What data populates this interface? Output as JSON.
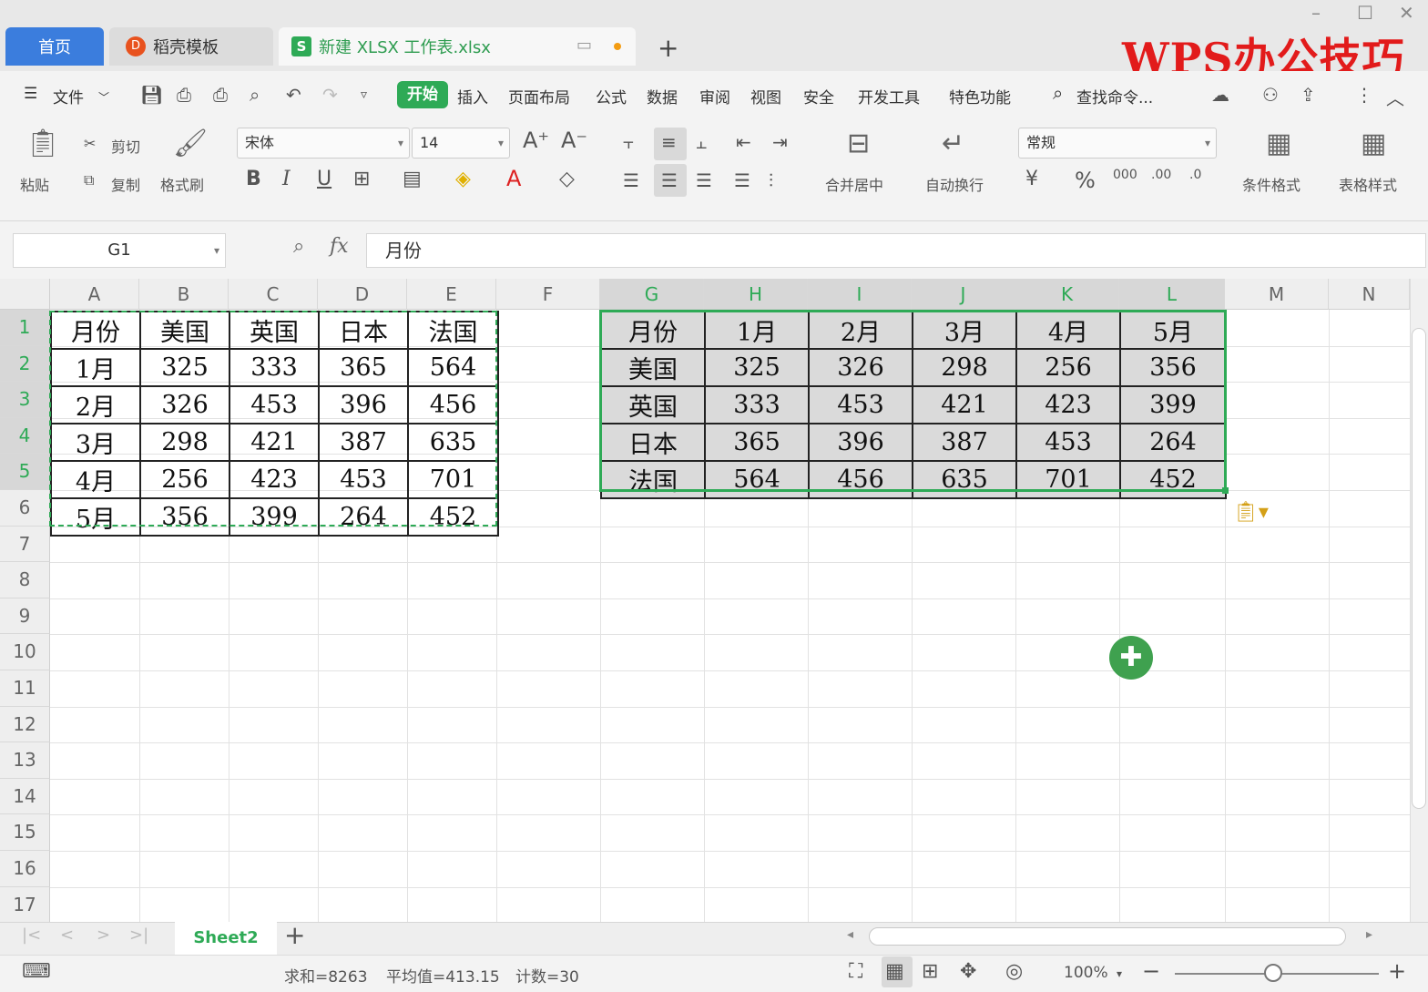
{
  "tabs": {
    "home": "首页",
    "template": "稻壳模板",
    "file": "新建 XLSX 工作表.xlsx",
    "new_tab": "+"
  },
  "watermark": "WPS办公技巧",
  "menu": {
    "file": "文件",
    "items": [
      "开始",
      "插入",
      "页面布局",
      "公式",
      "数据",
      "审阅",
      "视图",
      "安全",
      "开发工具",
      "特色功能"
    ],
    "search": "查找命令..."
  },
  "ribbon": {
    "paste": "粘贴",
    "cut": "剪切",
    "copy": "复制",
    "format_painter": "格式刷",
    "font_name": "宋体",
    "font_size": "14",
    "merge_center": "合并居中",
    "auto_wrap": "自动换行",
    "number_format": "常规",
    "conditional_format": "条件格式",
    "table_style": "表格样式",
    "bold": "B",
    "italic": "I",
    "underline": "U",
    "percent": "%"
  },
  "formula_bar": {
    "name_box": "G1",
    "fx": "fx",
    "formula": "月份"
  },
  "columns": [
    "A",
    "B",
    "C",
    "D",
    "E",
    "F",
    "G",
    "H",
    "I",
    "J",
    "K",
    "L",
    "M",
    "N"
  ],
  "rows": [
    "1",
    "2",
    "3",
    "4",
    "5",
    "6",
    "7",
    "8",
    "9",
    "10",
    "11",
    "12",
    "13",
    "14",
    "15",
    "16",
    "17"
  ],
  "source_table": [
    [
      "月份",
      "美国",
      "英国",
      "日本",
      "法国"
    ],
    [
      "1月",
      "325",
      "333",
      "365",
      "564"
    ],
    [
      "2月",
      "326",
      "453",
      "396",
      "456"
    ],
    [
      "3月",
      "298",
      "421",
      "387",
      "635"
    ],
    [
      "4月",
      "256",
      "423",
      "453",
      "701"
    ],
    [
      "5月",
      "356",
      "399",
      "264",
      "452"
    ]
  ],
  "transposed_table": [
    [
      "月份",
      "1月",
      "2月",
      "3月",
      "4月",
      "5月"
    ],
    [
      "美国",
      "325",
      "326",
      "298",
      "256",
      "356"
    ],
    [
      "英国",
      "333",
      "453",
      "421",
      "423",
      "399"
    ],
    [
      "日本",
      "365",
      "396",
      "387",
      "453",
      "264"
    ],
    [
      "法国",
      "564",
      "456",
      "635",
      "701",
      "452"
    ]
  ],
  "sheet_tabs": {
    "active": "Sheet2",
    "add": "+"
  },
  "status": {
    "sum": "求和=8263",
    "average": "平均值=413.15",
    "count": "计数=30",
    "zoom": "100%"
  },
  "colors": {
    "accent": "#2eaa56",
    "home_tab": "#3b7ddd",
    "watermark": "#e21b1b"
  }
}
